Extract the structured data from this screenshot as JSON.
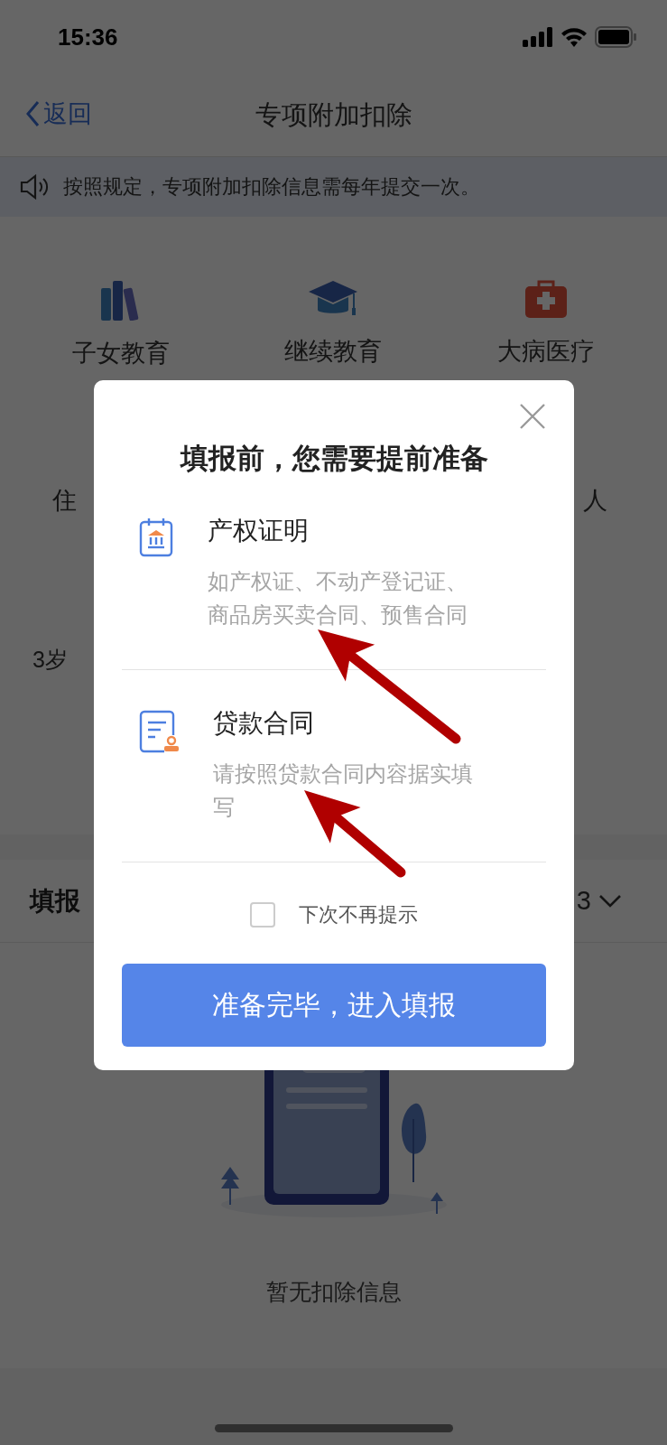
{
  "status_bar": {
    "time": "15:36"
  },
  "nav": {
    "back": "返回",
    "title": "专项附加扣除"
  },
  "notice": "按照规定，专项附加扣除信息需每年提交一次。",
  "categories": [
    {
      "label": "子女教育",
      "kind": "books"
    },
    {
      "label": "继续教育",
      "kind": "cap"
    },
    {
      "label": "大病医疗",
      "kind": "medkit"
    }
  ],
  "covered_texts": [
    "住",
    "人",
    "3岁"
  ],
  "records": {
    "title": "填报",
    "year": "3"
  },
  "empty_state": {
    "message": "暂无扣除信息"
  },
  "dialog": {
    "title": "填报前，您需要提前准备",
    "items": [
      {
        "kind": "deed",
        "title": "产权证明",
        "description": "如产权证、不动产登记证、商品房买卖合同、预售合同"
      },
      {
        "kind": "contract",
        "title": "贷款合同",
        "description": "请按照贷款合同内容据实填写"
      }
    ],
    "checkbox": {
      "label": "下次不再提示",
      "checked": false
    },
    "button": "准备完毕，进入填报"
  },
  "annotations": [
    {
      "kind": "arrow"
    },
    {
      "kind": "arrow"
    }
  ]
}
